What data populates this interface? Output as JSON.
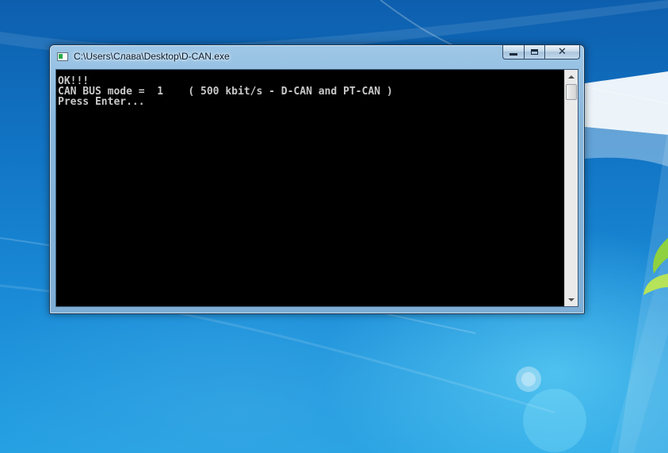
{
  "window": {
    "title": "C:\\Users\\Слава\\Desktop\\D-CAN.exe",
    "icon": "console-window-icon"
  },
  "caption_buttons": {
    "minimize": "minimize-icon",
    "maximize": "maximize-icon",
    "close": "close-icon",
    "close_glyph": "✕"
  },
  "console": {
    "lines": [
      "OK!!!",
      "CAN BUS mode =  1    ( 500 kbit/s - D-CAN and PT-CAN )",
      "Press Enter..."
    ],
    "text_color": "#c8c8c8",
    "background_color": "#000000"
  },
  "desktop": {
    "wallpaper": "windows-7-default-blue"
  }
}
